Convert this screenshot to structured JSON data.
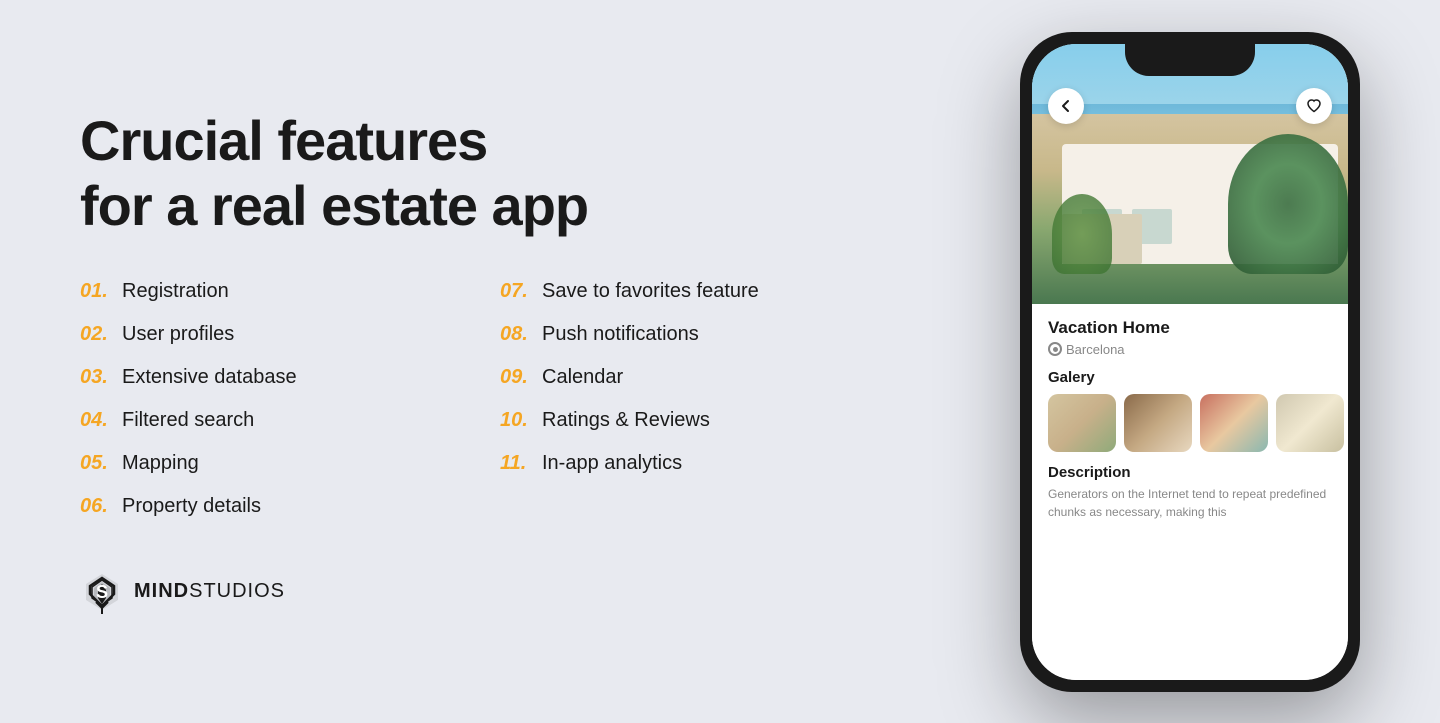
{
  "page": {
    "background": "#e8eaf0"
  },
  "headline": {
    "line1": "Crucial features",
    "line2": "for a real estate app"
  },
  "features": {
    "left_column": [
      {
        "num": "01.",
        "text": "Registration"
      },
      {
        "num": "02.",
        "text": "User profiles"
      },
      {
        "num": "03.",
        "text": "Extensive database"
      },
      {
        "num": "04.",
        "text": "Filtered search"
      },
      {
        "num": "05.",
        "text": "Mapping"
      },
      {
        "num": "06.",
        "text": "Property details"
      }
    ],
    "right_column": [
      {
        "num": "07.",
        "text": "Save to favorites feature"
      },
      {
        "num": "08.",
        "text": "Push notifications"
      },
      {
        "num": "09.",
        "text": "Calendar"
      },
      {
        "num": "10.",
        "text": "Ratings & Reviews"
      },
      {
        "num": "11.",
        "text": "In-app analytics"
      }
    ]
  },
  "logo": {
    "brand_bold": "MIND",
    "brand_regular": "STUDIOS"
  },
  "phone": {
    "property_title": "Vacation Home",
    "location": "Barcelona",
    "gallery_label": "Galery",
    "description_label": "Description",
    "description_text": "Generators on the Internet tend to repeat predefined chunks as necessary, making this"
  }
}
